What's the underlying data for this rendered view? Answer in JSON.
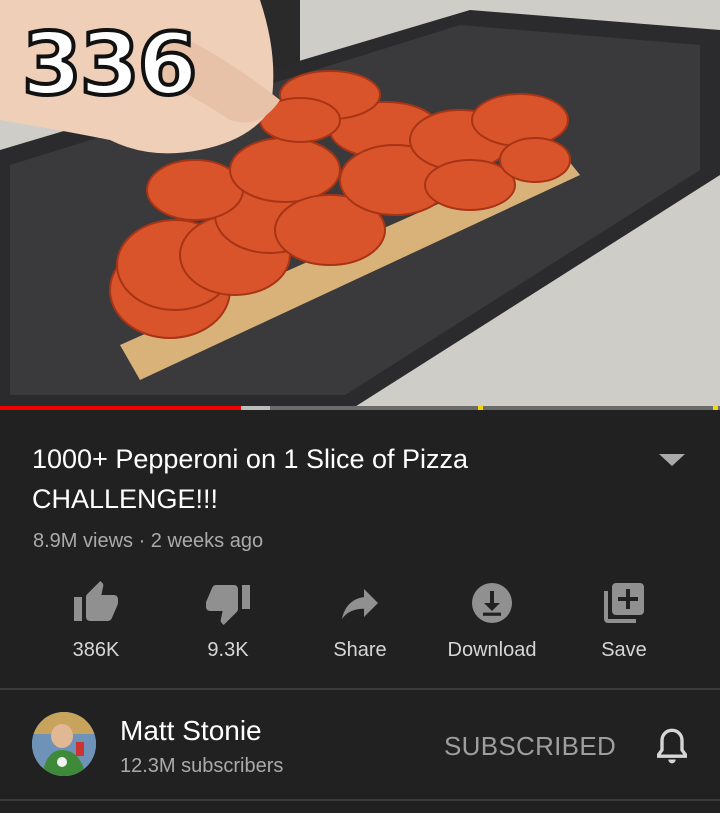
{
  "player": {
    "overlay_counter": "336",
    "progress_fraction": 0.335,
    "buffer_fraction": 0.375
  },
  "video": {
    "title": "1000+ Pepperoni on 1 Slice of Pizza CHALLENGE!!!",
    "meta": "8.9M views · 2 weeks ago"
  },
  "actions": [
    {
      "label": "386K",
      "icon": "thumbs-up-icon"
    },
    {
      "label": "9.3K",
      "icon": "thumbs-down-icon"
    },
    {
      "label": "Share",
      "icon": "share-icon"
    },
    {
      "label": "Download",
      "icon": "download-icon"
    },
    {
      "label": "Save",
      "icon": "save-to-playlist-icon"
    }
  ],
  "channel": {
    "name": "Matt Stonie",
    "subscribers": "12.3M subscribers",
    "subscribe_state": "SUBSCRIBED"
  },
  "colors": {
    "background": "#212121",
    "progress_played": "#ee0000",
    "secondary_text": "#aaaaaa"
  }
}
